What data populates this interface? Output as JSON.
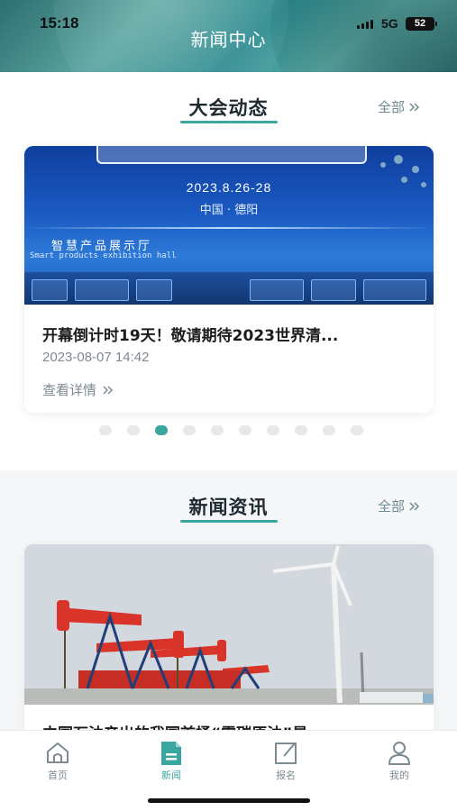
{
  "status_bar": {
    "time": "15:18",
    "network": "5G",
    "battery": "52"
  },
  "header": {
    "title": "新闻中心"
  },
  "events_section": {
    "title": "大会动态",
    "more_label": "全部",
    "card": {
      "banner_date": "2023.8.26-28",
      "banner_location": "中国 · 德阳",
      "banner_hall_cn": "智慧产品展示厅",
      "banner_hall_en": "Smart products exhibition hall",
      "title": "开幕倒计时19天！敬请期待2023世界清...",
      "date": "2023-08-07 14:42",
      "detail_label": "查看详情"
    },
    "carousel": {
      "count": 10,
      "active_index": 2
    }
  },
  "news_section": {
    "title": "新闻资讯",
    "more_label": "全部",
    "card": {
      "title": "中国石油产出的我国首桶“零碳原油”是"
    }
  },
  "tabbar": {
    "items": [
      {
        "label": "首页",
        "icon": "home-icon",
        "active": false
      },
      {
        "label": "新闻",
        "icon": "news-icon",
        "active": true
      },
      {
        "label": "报名",
        "icon": "signup-icon",
        "active": false
      },
      {
        "label": "我的",
        "icon": "profile-icon",
        "active": false
      }
    ]
  },
  "colors": {
    "accent": "#3aa6a0",
    "muted": "#7a8a92"
  }
}
